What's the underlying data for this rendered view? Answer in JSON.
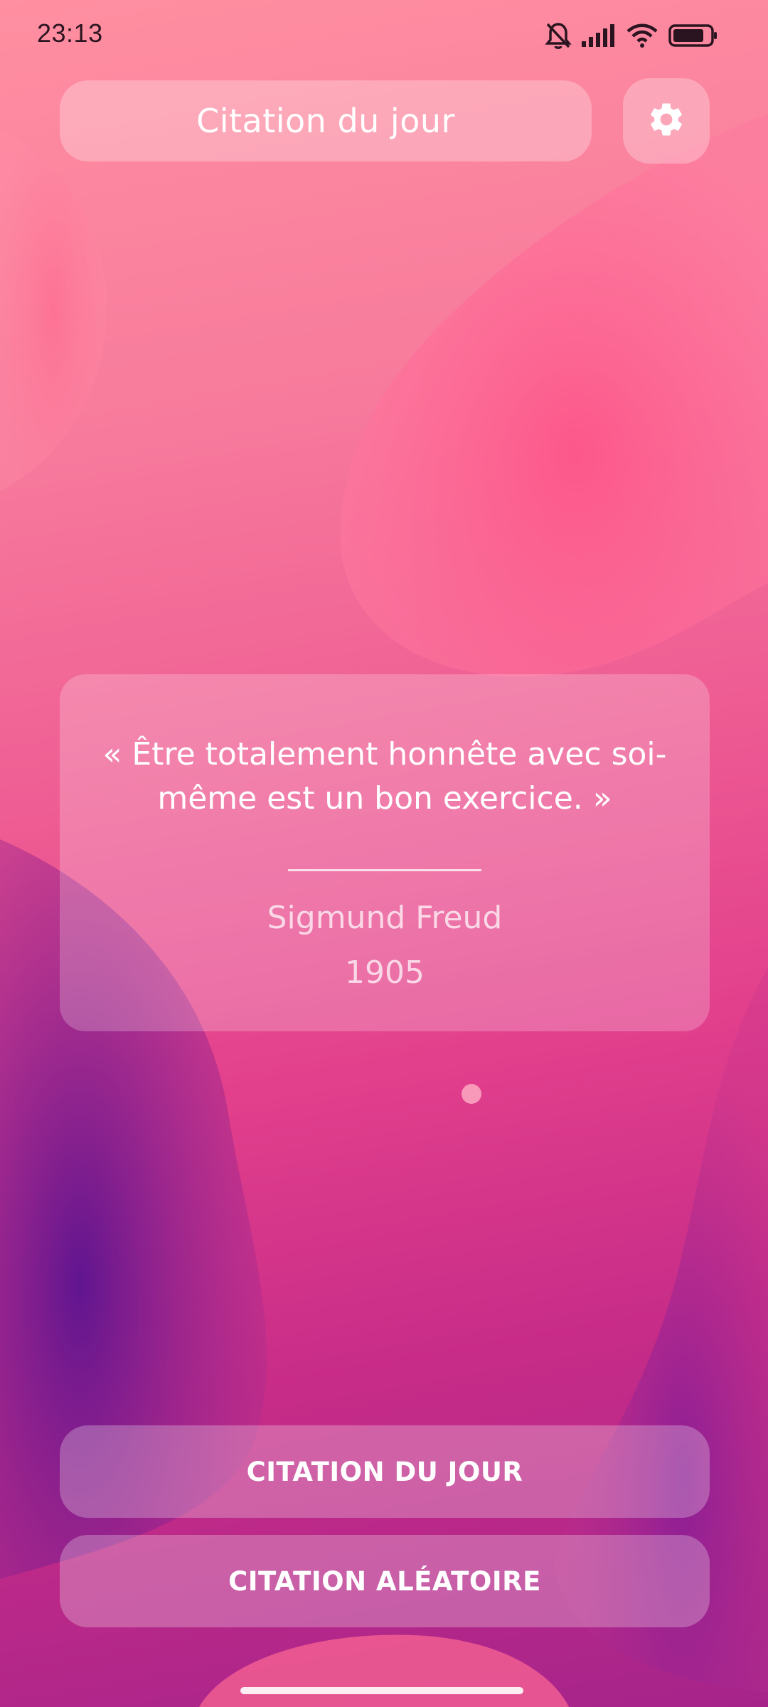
{
  "status_bar": {
    "time": "23:13",
    "icons": [
      "bell-muted-icon",
      "signal-icon",
      "wifi-icon",
      "battery-icon"
    ]
  },
  "header": {
    "title": "Citation du jour",
    "settings_icon": "gear-icon"
  },
  "quote": {
    "text": "« Être totalement honnête avec soi-même est un bon exercice. »",
    "author": "Sigmund Freud",
    "year": "1905"
  },
  "actions": {
    "today_label": "CITATION DU JOUR",
    "random_label": "CITATION ALÉATOIRE"
  },
  "colors": {
    "accent": "#e23f8c",
    "background_top": "#ff8fa1",
    "background_bottom": "#a6248a"
  }
}
